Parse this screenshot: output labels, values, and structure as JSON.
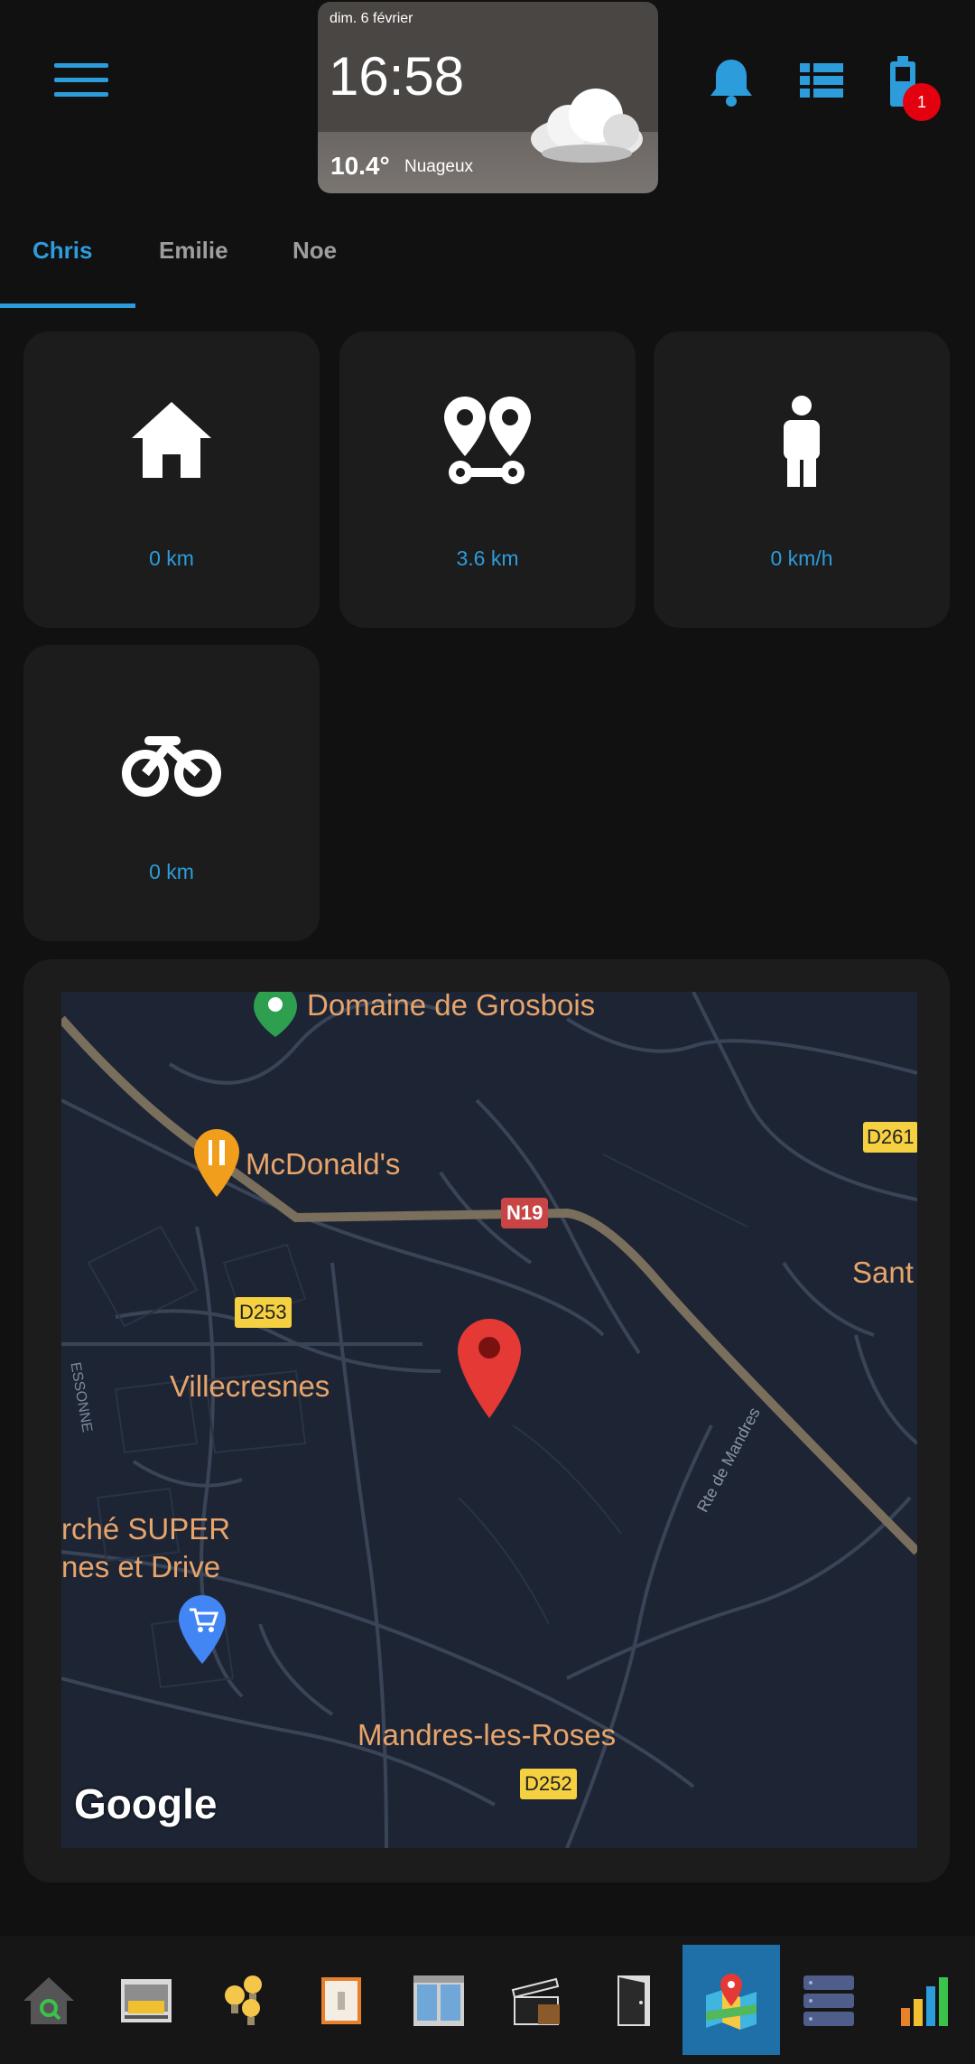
{
  "header": {
    "menu_icon": "hamburger-menu-icon",
    "notification_icon": "bell-icon",
    "list_icon": "list-icon",
    "battery_icon": "battery-icon",
    "battery_badge": "1",
    "accent_color": "#2d9cdb",
    "badge_color": "#e3000f"
  },
  "weather": {
    "date": "dim. 6 février",
    "time": "16:58",
    "temperature": "10.4°",
    "condition": "Nuageux",
    "icon": "cloud-icon"
  },
  "tabs": [
    {
      "label": "Chris",
      "active": true
    },
    {
      "label": "Emilie",
      "active": false
    },
    {
      "label": "Noe",
      "active": false
    }
  ],
  "cards": [
    {
      "icon": "home-icon",
      "value": "0 km"
    },
    {
      "icon": "route-icon",
      "value": "3.6 km"
    },
    {
      "icon": "person-icon",
      "value": "0 km/h"
    },
    {
      "icon": "bicycle-icon",
      "value": "0 km"
    }
  ],
  "map": {
    "labels": {
      "domaine": "Domaine de Grosbois",
      "mcdonalds": "McDonald's",
      "n19": "N19",
      "d261": "D261",
      "sant": "Sant",
      "d253": "D253",
      "essonne": "ESSONNE",
      "villecresnes": "Villecresnes",
      "super1": "rché SUPER",
      "super2": "nes et Drive",
      "rte": "Rte de Mandres",
      "mandres": "Mandres-les-Roses",
      "d252": "D252",
      "google": "Google"
    }
  },
  "bottom_nav": [
    {
      "icon": "home-search-icon",
      "active": false
    },
    {
      "icon": "garage-icon",
      "active": false
    },
    {
      "icon": "bulbs-icon",
      "active": false
    },
    {
      "icon": "switch-icon",
      "active": false
    },
    {
      "icon": "window-icon",
      "active": false
    },
    {
      "icon": "clapperboard-icon",
      "active": false
    },
    {
      "icon": "door-icon",
      "active": false
    },
    {
      "icon": "map-icon",
      "active": true
    },
    {
      "icon": "server-icon",
      "active": false
    },
    {
      "icon": "bar-chart-icon",
      "active": false
    }
  ]
}
